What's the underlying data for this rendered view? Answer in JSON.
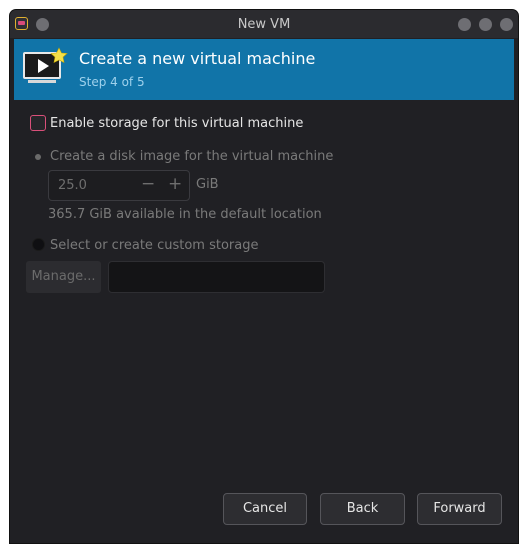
{
  "window": {
    "title": "New VM"
  },
  "banner": {
    "heading": "Create a new virtual machine",
    "step": "Step 4 of 5"
  },
  "storage": {
    "enable_label": "Enable storage for this virtual machine",
    "enable_checked": false,
    "disk_image_label": "Create a disk image for the virtual machine",
    "size_value": "25.0",
    "size_unit": "GiB",
    "available_text": "365.7 GiB available in the default location",
    "custom_label": "Select or create custom storage",
    "manage_label": "Manage...",
    "custom_path": ""
  },
  "buttons": {
    "cancel": "Cancel",
    "back": "Back",
    "forward": "Forward"
  },
  "colors": {
    "accent": "#1174a8",
    "checkbox_border": "#d9507a",
    "background": "#202024"
  }
}
